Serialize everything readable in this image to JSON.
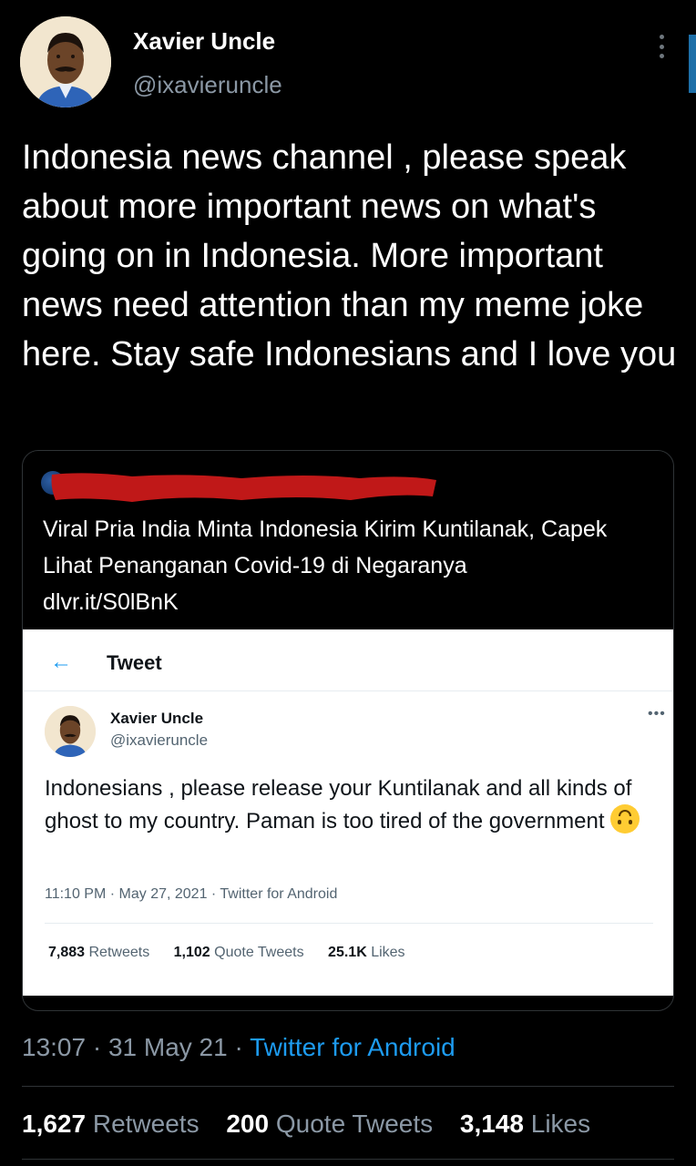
{
  "author": {
    "name": "Xavier Uncle",
    "handle": "@ixavieruncle"
  },
  "tweet": {
    "text": "Indonesia news channel , please speak about more important news on what's going on in Indonesia. More important news need attention than my meme joke here. Stay safe Indonesians and I love you"
  },
  "quote": {
    "text": "Viral Pria India Minta Indonesia Kirim Kuntilanak, Capek Lihat Penanganan Covid-19 di Negaranya",
    "link": "dlvr.it/S0lBnK",
    "screenshot": {
      "back_icon": "←",
      "title": "Tweet",
      "author_name": "Xavier Uncle",
      "author_handle": "@ixavieruncle",
      "more_icon": "•••",
      "text": "Indonesians , please release your Kuntilanak and all kinds of ghost to my country. Paman is too tired of the government",
      "emoji": "upside-down-face",
      "meta": "11:10 PM · May 27, 2021 · Twitter for Android",
      "retweets_count": "7,883",
      "retweets_label": "Retweets",
      "quotes_count": "1,102",
      "quotes_label": "Quote Tweets",
      "likes_count": "25.1K",
      "likes_label": "Likes"
    }
  },
  "meta": {
    "time_date": "13:07 · 31 May 21 · ",
    "source": "Twitter for Android"
  },
  "stats": {
    "retweets_count": "1,627",
    "retweets_label": "Retweets",
    "quotes_count": "200",
    "quotes_label": "Quote Tweets",
    "likes_count": "3,148",
    "likes_label": "Likes"
  },
  "colors": {
    "background": "#000000",
    "link": "#1d9bf0",
    "muted": "#8b98a5",
    "redaction": "#c01818"
  }
}
